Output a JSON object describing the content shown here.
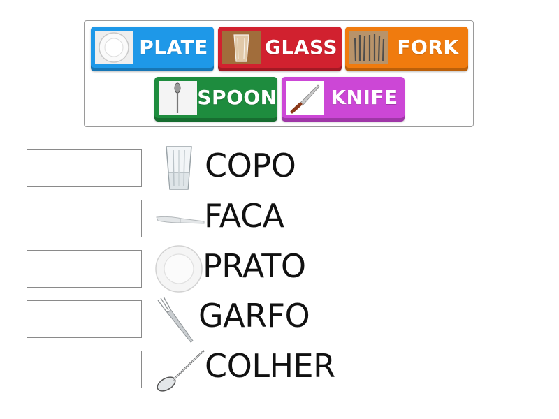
{
  "colors": {
    "plate": "#1e98e8",
    "glass": "#d1212f",
    "fork": "#f07b0e",
    "spoon": "#1e8c3e",
    "knife": "#cc47d6"
  },
  "tiles": [
    {
      "label": "PLATE",
      "icon": "plate-icon"
    },
    {
      "label": "GLASS",
      "icon": "glass-icon"
    },
    {
      "label": "FORK",
      "icon": "fork-icon"
    },
    {
      "label": "SPOON",
      "icon": "spoon-icon"
    },
    {
      "label": "KNIFE",
      "icon": "knife-icon"
    }
  ],
  "rows": [
    {
      "word": "COPO",
      "icon": "glass-icon"
    },
    {
      "word": "FACA",
      "icon": "knife-icon"
    },
    {
      "word": "PRATO",
      "icon": "plate-icon"
    },
    {
      "word": "GARFO",
      "icon": "fork-icon"
    },
    {
      "word": "COLHER",
      "icon": "spoon-icon"
    }
  ]
}
